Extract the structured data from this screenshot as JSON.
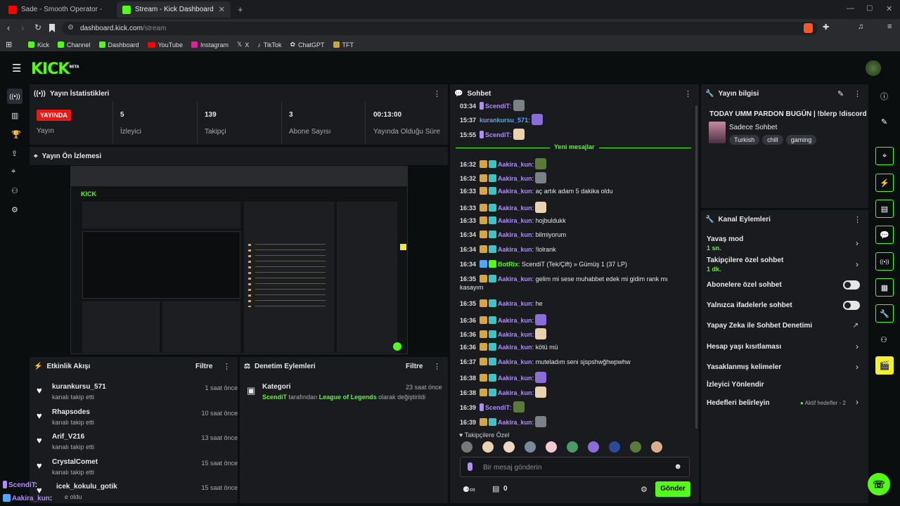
{
  "browser": {
    "tabs": [
      {
        "label": "Sade - Smooth Operator - Offici",
        "active": false
      },
      {
        "label": "Stream - Kick Dashboard",
        "active": true
      }
    ],
    "url_host": "dashboard.kick.com",
    "url_path": "/stream",
    "bookmarks": [
      "Kick",
      "Channel",
      "Dashboard",
      "YouTube",
      "Instagram",
      "X",
      "TikTok",
      "ChatGPT",
      "TFT"
    ]
  },
  "app": {
    "logo": "KICK",
    "beta": "BETA"
  },
  "stats": {
    "title": "Yayın İstatistikleri",
    "live_badge": "YAYINDA",
    "live_label": "Yayın",
    "items": [
      {
        "value": "5",
        "label": "İzleyici"
      },
      {
        "value": "139",
        "label": "Takipçi"
      },
      {
        "value": "3",
        "label": "Abone Sayısı"
      },
      {
        "value": "00:13:00",
        "label": "Yayında Olduğu Süre"
      }
    ]
  },
  "preview": {
    "title": "Yayın Ön İzlemesi"
  },
  "activity": {
    "title": "Etkinlik Akışı",
    "filter": "Filtre",
    "events": [
      {
        "name": "kurankursu_571",
        "sub": "kanalı takip etti",
        "time": "1 saat önce"
      },
      {
        "name": "Rhapsodes",
        "sub": "kanalı takip etti",
        "time": "10 saat önce"
      },
      {
        "name": "Arif_V216",
        "sub": "kanalı takip etti",
        "time": "13 saat önce"
      },
      {
        "name": "CrystalComet",
        "sub": "kanalı takip etti",
        "time": "15 saat önce"
      },
      {
        "name": "icek_kokulu_gotik",
        "sub": "e oldu",
        "time": "15 saat önce"
      }
    ]
  },
  "moderation": {
    "title": "Denetim Eylemleri",
    "filter": "Filtre",
    "entry_title": "Kategori",
    "entry_time": "23 saat önce",
    "entry_user": "ScendiT",
    "entry_mid": "tarafından",
    "entry_cat": "League of Legends",
    "entry_end": "olarak değiştirildi"
  },
  "chat": {
    "title": "Sohbet",
    "new_messages": "Yeni mesajlar",
    "messages": [
      {
        "time": "03:34",
        "user": "ScendiT",
        "text": ":",
        "color": "purple",
        "emote": true
      },
      {
        "time": "15:37",
        "user": "kurankursu_571",
        "text": ":",
        "color": "blue",
        "emote": true
      },
      {
        "time": "15:55",
        "user": "ScendiT",
        "text": ":",
        "color": "purple",
        "emote": true
      },
      {
        "time": "16:32",
        "user": "Aakira_kun",
        "text": ":",
        "color": "purple",
        "emote": true
      },
      {
        "time": "16:32",
        "user": "Aakira_kun",
        "text": ":",
        "color": "purple",
        "emote": true
      },
      {
        "time": "16:33",
        "user": "Aakira_kun",
        "text": ": aç artık adam 5 dakika oldu",
        "color": "purple",
        "emote": false
      },
      {
        "time": "16:33",
        "user": "Aakira_kun",
        "text": ":",
        "color": "purple",
        "emote": true
      },
      {
        "time": "16:33",
        "user": "Aakira_kun",
        "text": ": hojbuldukk",
        "color": "purple",
        "emote": false
      },
      {
        "time": "16:34",
        "user": "Aakira_kun",
        "text": ": bilmiyorum",
        "color": "purple",
        "emote": false
      },
      {
        "time": "16:34",
        "user": "Aakira_kun",
        "text": ": !lolrank",
        "color": "purple",
        "emote": false
      },
      {
        "time": "16:34",
        "user": "BotRix",
        "text": ": ScendiT (Tek/Çift) » Gümüş 1 (37 LP)",
        "color": "green",
        "emote": false
      },
      {
        "time": "16:35",
        "user": "Aakira_kun",
        "text": ": gelim mi sese muhabbet edek mi gidim rank mı",
        "text2": "kasayım",
        "color": "purple",
        "emote": false
      },
      {
        "time": "16:35",
        "user": "Aakira_kun",
        "text": ": he",
        "color": "purple",
        "emote": false
      },
      {
        "time": "16:36",
        "user": "Aakira_kun",
        "text": ":",
        "color": "purple",
        "emote": true
      },
      {
        "time": "16:36",
        "user": "Aakira_kun",
        "text": ":",
        "color": "purple",
        "emote": true
      },
      {
        "time": "16:36",
        "user": "Aakira_kun",
        "text": ": kötü mü",
        "color": "purple",
        "emote": false
      },
      {
        "time": "16:37",
        "user": "Aakira_kun",
        "text": ": muteladım seni sjspshwğhwpwhw",
        "color": "purple",
        "emote": false
      },
      {
        "time": "16:38",
        "user": "Aakira_kun",
        "text": ":",
        "color": "purple",
        "emote": true
      },
      {
        "time": "16:38",
        "user": "Aakira_kun",
        "text": ":",
        "color": "purple",
        "emote": true
      },
      {
        "time": "16:39",
        "user": "ScendiT",
        "text": ":",
        "color": "purple",
        "emote": true
      },
      {
        "time": "16:39",
        "user": "Aakira_kun",
        "text": ":",
        "color": "purple",
        "emote": true
      }
    ],
    "followers_only": "Takipçilere Özel",
    "input_placeholder": "Bir mesaj gönderin",
    "send": "Gönder",
    "count": "0"
  },
  "stream_info": {
    "title": "Yayın bilgisi",
    "stream_title": "TODAY UMM PARDON BUGÜN | !blerp !discord",
    "category": "Sadece Sohbet",
    "tags": [
      "Turkish",
      "chill",
      "gaming"
    ]
  },
  "channel_actions": {
    "title": "Kanal Eylemleri",
    "items": [
      {
        "label": "Yavaş mod",
        "sub": "1 sn.",
        "kind": "chevron"
      },
      {
        "label": "Takipçilere özel sohbet",
        "sub": "1 dk.",
        "kind": "chevron"
      },
      {
        "label": "Abonelere özel sohbet",
        "sub": "",
        "kind": "toggle"
      },
      {
        "label": "Yalnızca ifadelerle sohbet",
        "sub": "",
        "kind": "toggle"
      },
      {
        "label": "Yapay Zeka ile Sohbet Denetimi",
        "sub": "",
        "kind": "external"
      },
      {
        "label": "Hesap yaşı kısıtlaması",
        "sub": "",
        "kind": "chevron"
      },
      {
        "label": "Yasaklanmış kelimeler",
        "sub": "",
        "kind": "chevron"
      },
      {
        "label": "İzleyici Yönlendir",
        "sub": "",
        "kind": "none"
      },
      {
        "label": "Hedefleri belirleyin",
        "sub": "",
        "kind": "chevron",
        "status": "Aktif hedefler - 2"
      }
    ]
  },
  "overlay": [
    {
      "user": "ScendiT",
      "text": ":"
    },
    {
      "user": "Aakira_kun",
      "text": ":"
    }
  ],
  "colors": {
    "accent": "#53fc18",
    "live": "#e91916",
    "purple": "#b08cff"
  }
}
